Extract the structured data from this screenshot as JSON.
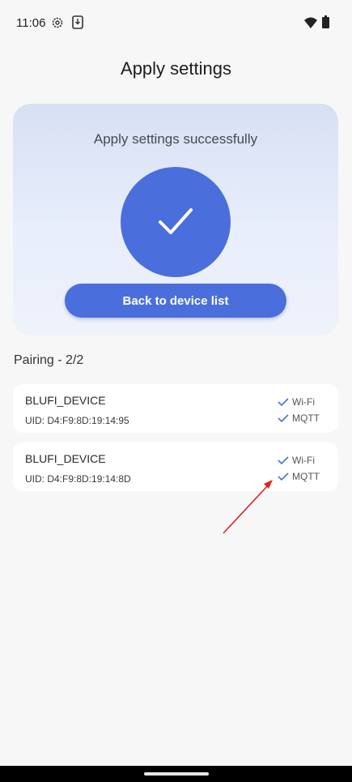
{
  "status_bar": {
    "time": "11:06",
    "settings_icon": "gear-icon",
    "download_icon": "download-icon",
    "wifi_icon": "wifi-icon",
    "battery_icon": "battery-icon"
  },
  "page": {
    "title": "Apply settings"
  },
  "result_card": {
    "message": "Apply settings successfully",
    "icon": "checkmark-icon",
    "button_label": "Back to device list",
    "accent_color": "#4a6fdc"
  },
  "pairing": {
    "label": "Pairing - 2/2",
    "devices": [
      {
        "name": "BLUFI_DEVICE",
        "uid": "UID: D4:F9:8D:19:14:95",
        "wifi_label": "Wi-Fi",
        "mqtt_label": "MQTT"
      },
      {
        "name": "BLUFI_DEVICE",
        "uid": "UID: D4:F9:8D:19:14:8D",
        "wifi_label": "Wi-Fi",
        "mqtt_label": "MQTT"
      }
    ]
  },
  "annotation": {
    "color": "#e02020"
  }
}
